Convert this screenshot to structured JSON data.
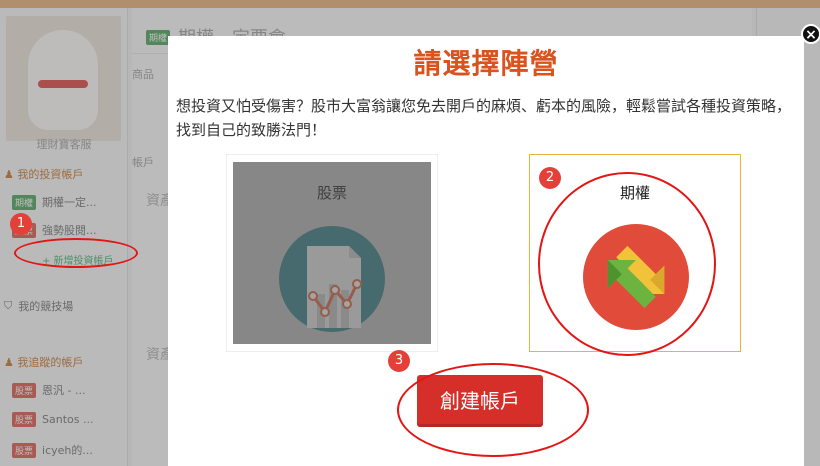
{
  "background": {
    "mascot_caption": "理財寶客服",
    "my_accounts_heading": "我的投資帳戶",
    "accounts": [
      {
        "tag": "期權",
        "name": "期權一定..."
      },
      {
        "tag": "股票",
        "name": "強勢股閱..."
      }
    ],
    "new_account_link": "+ 新增投資帳戶",
    "my_competition": "我的競技場",
    "followed_heading": "我追蹤的帳戶",
    "followed": [
      {
        "tag": "股票",
        "name": "恩汎 - ..."
      },
      {
        "tag": "股票",
        "name": "Santos ..."
      },
      {
        "tag": "股票",
        "name": "icyeh的..."
      }
    ],
    "main_title_tag": "期權",
    "main_title": "期權一定要會",
    "main_product_label": "商品",
    "main_account_label": "帳戶",
    "main_block_1": "資產",
    "main_block_2": "資產"
  },
  "modal": {
    "title": "請選擇陣營",
    "description": "想投資又怕受傷害？股市大富翁讓您免去開戶的麻煩、虧本的風險，輕鬆嘗試各種投資策略，找到自己的致勝法門！",
    "close_symbol": "×",
    "stock_card": {
      "label": "股票",
      "icon": "stock-chart-icon"
    },
    "option_card": {
      "label": "期權",
      "icon": "option-arrows-icon"
    },
    "create_button": "創建帳戶"
  },
  "annotations": {
    "badge_1": "1",
    "badge_2": "2",
    "badge_3": "3"
  },
  "colors": {
    "accent_orange": "#d9531e",
    "button_red": "#d62f2a",
    "annotation_red": "#e31616",
    "option_border": "#f0b040"
  }
}
